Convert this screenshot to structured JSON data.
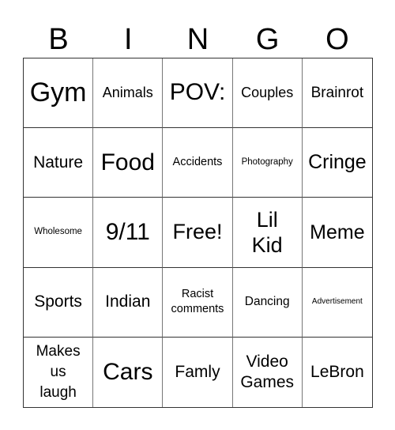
{
  "header": {
    "letters": [
      "B",
      "I",
      "N",
      "G",
      "O"
    ]
  },
  "card": {
    "rows": [
      [
        "Gym",
        "Animals",
        "POV:",
        "Couples",
        "Brainrot"
      ],
      [
        "Nature",
        "Food",
        "Accidents",
        "Photography",
        "Cringe"
      ],
      [
        "Wholesome",
        "9/11",
        "Free!",
        "Lil Kid",
        "Meme"
      ],
      [
        "Sports",
        "Indian",
        "Racist comments",
        "Dancing",
        "Advertisement"
      ],
      [
        "Makes us laugh",
        "Cars",
        "Famly",
        "Video Games",
        "LeBron"
      ]
    ],
    "free_space": "Free!"
  }
}
